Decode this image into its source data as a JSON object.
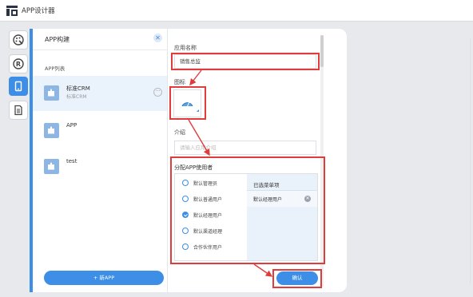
{
  "app": {
    "title": "APP设计器"
  },
  "rail": {
    "items": [
      {
        "icon": "palette-icon",
        "active": false
      },
      {
        "icon": "registered-icon",
        "active": false
      },
      {
        "icon": "mobile-icon",
        "active": true
      },
      {
        "icon": "document-icon",
        "active": false
      }
    ]
  },
  "list_panel": {
    "header": "APP构建",
    "close_label": "✕",
    "section_label": "APP列表",
    "items": [
      {
        "name": "标准CRM",
        "sub": "标准CRM",
        "more": "···"
      },
      {
        "name": "APP",
        "sub": ""
      },
      {
        "name": "test",
        "sub": ""
      }
    ],
    "new_button": "+ 新APP"
  },
  "form": {
    "name_label": "应用名称",
    "name_value": "销售总监",
    "icon_label": "图标",
    "intro_label": "介绍",
    "intro_placeholder": "请输入应用介绍",
    "assign_label": "分配APP使用者",
    "options": [
      {
        "label": "默认管理员",
        "checked": false
      },
      {
        "label": "默认普通用户",
        "checked": false
      },
      {
        "label": "默认经理用户",
        "checked": true
      },
      {
        "label": "默认渠道经理",
        "checked": false
      },
      {
        "label": "合作伙伴用户",
        "checked": false
      }
    ],
    "selected_title": "已选菜单项",
    "selected_items": [
      "默认经理用户"
    ],
    "remove_label": "✕",
    "confirm_button": "确认"
  },
  "colors": {
    "accent": "#3c8ee6",
    "highlight": "#e03c3c"
  }
}
